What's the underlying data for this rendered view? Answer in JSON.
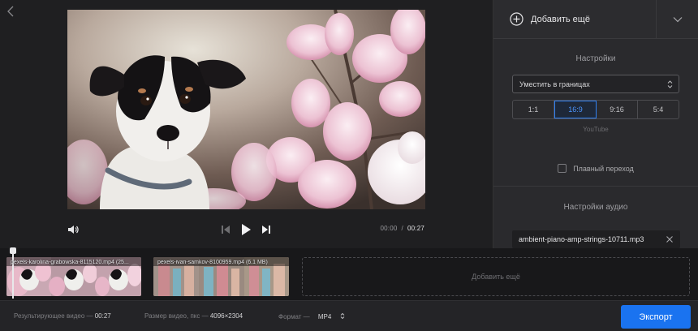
{
  "player": {
    "time_current": "00:00",
    "time_separator": "/",
    "time_duration": "00:27"
  },
  "settings": {
    "add_more_label": "Добавить ещё",
    "title": "Настройки",
    "fit_mode": "Уместить в границах",
    "ratios": [
      {
        "label": "1:1",
        "active": false
      },
      {
        "label": "16:9",
        "active": true
      },
      {
        "label": "9:16",
        "active": false
      },
      {
        "label": "5:4",
        "active": false
      }
    ],
    "ratio_hint": "YouTube",
    "smooth_transition_label": "Плавный переход",
    "smooth_transition_checked": false,
    "audio_title": "Настройки аудио",
    "audio_file": "ambient-piano-amp-strings-10711.mp3"
  },
  "timeline": {
    "clips": [
      {
        "label": "pexels-karolina-grabowska-8115120.mp4 (25..."
      },
      {
        "label": "pexels-ivan-samkov-8100959.mp4 (6.1 MB)"
      }
    ],
    "add_more_label": "Добавить ещё"
  },
  "footer": {
    "result_label": "Результирующее видео —",
    "result_value": "00:27",
    "size_label": "Размер видео, пкс —",
    "size_value": "4096×2304",
    "format_label": "Формат —",
    "format_value": "MP4",
    "export_label": "Экспорт"
  },
  "colors": {
    "accent": "#1a73f0",
    "active_ratio": "#4c95ff",
    "panel": "#2a2a2d",
    "background": "#1f1f21"
  }
}
